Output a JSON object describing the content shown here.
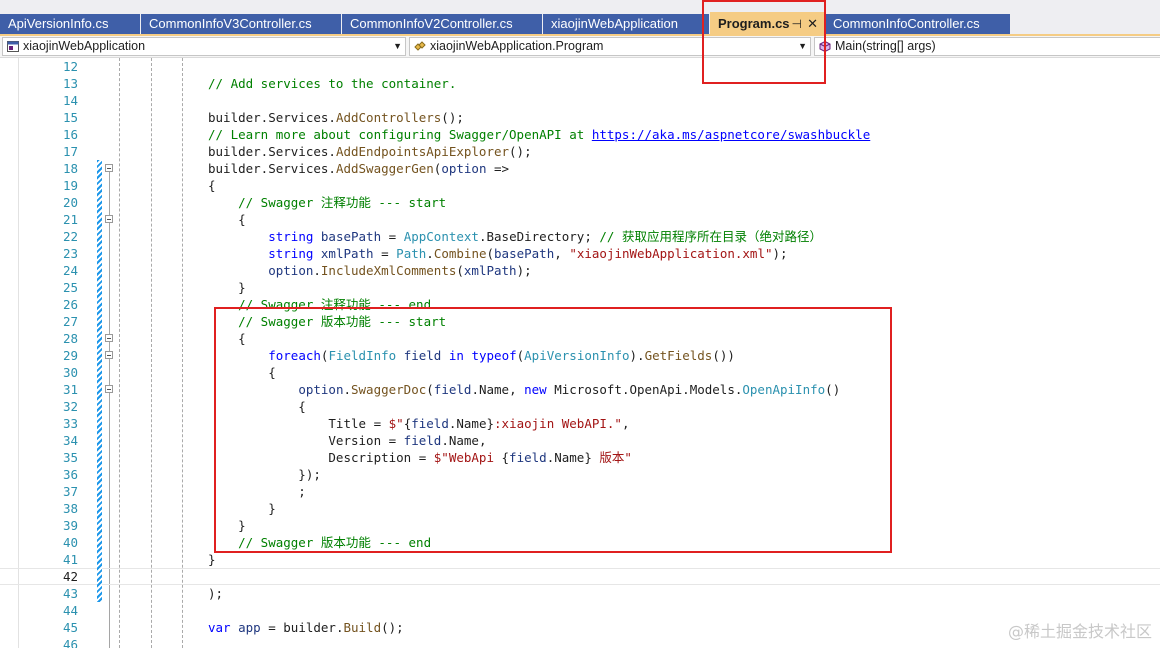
{
  "tabs": [
    {
      "label": "ApiVersionInfo.cs",
      "active": false
    },
    {
      "label": "CommonInfoV3Controller.cs",
      "active": false
    },
    {
      "label": "CommonInfoV2Controller.cs",
      "active": false
    },
    {
      "label": "xiaojinWebApplication",
      "active": false
    },
    {
      "label": "Program.cs",
      "active": true,
      "pin_icon": "pin-icon",
      "close_icon": "close-icon"
    },
    {
      "label": "CommonInfoController.cs",
      "active": false
    }
  ],
  "navbar": {
    "project": {
      "label": "xiaojinWebApplication",
      "icon": "csharp-project-icon"
    },
    "class": {
      "label": "xiaojinWebApplication.Program",
      "icon": "class-icon"
    },
    "member": {
      "label": "Main(string[] args)",
      "icon": "method-cube-icon"
    }
  },
  "editor": {
    "current_line": 42,
    "lines": [
      {
        "n": 12,
        "tokens": []
      },
      {
        "n": 13,
        "tokens": [
          {
            "t": "// Add services to the container.",
            "c": "comment"
          }
        ]
      },
      {
        "n": 14,
        "tokens": []
      },
      {
        "n": 15,
        "tokens": [
          {
            "t": "builder.Services.",
            "c": "plain"
          },
          {
            "t": "AddControllers",
            "c": "method"
          },
          {
            "t": "();",
            "c": "plain"
          }
        ]
      },
      {
        "n": 16,
        "tokens": [
          {
            "t": "// Learn more about configuring Swagger/OpenAPI at ",
            "c": "comment"
          },
          {
            "t": "https://aka.ms/aspnetcore/swashbuckle",
            "c": "link"
          }
        ]
      },
      {
        "n": 17,
        "tokens": [
          {
            "t": "builder.Services.",
            "c": "plain"
          },
          {
            "t": "AddEndpointsApiExplorer",
            "c": "method"
          },
          {
            "t": "();",
            "c": "plain"
          }
        ]
      },
      {
        "n": 18,
        "tokens": [
          {
            "t": "builder.Services.",
            "c": "plain"
          },
          {
            "t": "AddSwaggerGen",
            "c": "method"
          },
          {
            "t": "(",
            "c": "plain"
          },
          {
            "t": "option",
            "c": "param"
          },
          {
            "t": " =>",
            "c": "plain"
          }
        ],
        "fold": true,
        "change": true
      },
      {
        "n": 19,
        "tokens": [
          {
            "t": "{",
            "c": "plain"
          }
        ],
        "change": true
      },
      {
        "n": 20,
        "tokens": [
          {
            "t": "    // Swagger 注释功能 --- start",
            "c": "comment"
          }
        ],
        "change": true
      },
      {
        "n": 21,
        "tokens": [
          {
            "t": "    {",
            "c": "plain"
          }
        ],
        "fold": true,
        "change": true
      },
      {
        "n": 22,
        "tokens": [
          {
            "t": "        ",
            "c": "plain"
          },
          {
            "t": "string",
            "c": "kw"
          },
          {
            "t": " ",
            "c": "plain"
          },
          {
            "t": "basePath",
            "c": "param"
          },
          {
            "t": " = ",
            "c": "plain"
          },
          {
            "t": "AppContext",
            "c": "type"
          },
          {
            "t": ".BaseDirectory; ",
            "c": "plain"
          },
          {
            "t": "// 获取应用程序所在目录（绝对路径）",
            "c": "comment"
          }
        ],
        "change": true
      },
      {
        "n": 23,
        "tokens": [
          {
            "t": "        ",
            "c": "plain"
          },
          {
            "t": "string",
            "c": "kw"
          },
          {
            "t": " ",
            "c": "plain"
          },
          {
            "t": "xmlPath",
            "c": "param"
          },
          {
            "t": " = ",
            "c": "plain"
          },
          {
            "t": "Path",
            "c": "type"
          },
          {
            "t": ".",
            "c": "plain"
          },
          {
            "t": "Combine",
            "c": "method"
          },
          {
            "t": "(",
            "c": "plain"
          },
          {
            "t": "basePath",
            "c": "param"
          },
          {
            "t": ", ",
            "c": "plain"
          },
          {
            "t": "\"xiaojinWebApplication.xml\"",
            "c": "str"
          },
          {
            "t": ");",
            "c": "plain"
          }
        ],
        "change": true
      },
      {
        "n": 24,
        "tokens": [
          {
            "t": "        ",
            "c": "plain"
          },
          {
            "t": "option",
            "c": "param"
          },
          {
            "t": ".",
            "c": "plain"
          },
          {
            "t": "IncludeXmlComments",
            "c": "method"
          },
          {
            "t": "(",
            "c": "plain"
          },
          {
            "t": "xmlPath",
            "c": "param"
          },
          {
            "t": ");",
            "c": "plain"
          }
        ],
        "change": true
      },
      {
        "n": 25,
        "tokens": [
          {
            "t": "    }",
            "c": "plain"
          }
        ],
        "change": true
      },
      {
        "n": 26,
        "tokens": [
          {
            "t": "    // Swagger 注释功能 --- end",
            "c": "comment"
          }
        ],
        "change": true
      },
      {
        "n": 27,
        "tokens": [
          {
            "t": "    // Swagger 版本功能 --- start",
            "c": "comment"
          }
        ],
        "change": true
      },
      {
        "n": 28,
        "tokens": [
          {
            "t": "    {",
            "c": "plain"
          }
        ],
        "fold": true,
        "change": true
      },
      {
        "n": 29,
        "tokens": [
          {
            "t": "        ",
            "c": "plain"
          },
          {
            "t": "foreach",
            "c": "kw"
          },
          {
            "t": "(",
            "c": "plain"
          },
          {
            "t": "FieldInfo",
            "c": "type"
          },
          {
            "t": " ",
            "c": "plain"
          },
          {
            "t": "field",
            "c": "param"
          },
          {
            "t": " ",
            "c": "plain"
          },
          {
            "t": "in",
            "c": "kw"
          },
          {
            "t": " ",
            "c": "plain"
          },
          {
            "t": "typeof",
            "c": "kw"
          },
          {
            "t": "(",
            "c": "plain"
          },
          {
            "t": "ApiVersionInfo",
            "c": "type"
          },
          {
            "t": ").",
            "c": "plain"
          },
          {
            "t": "GetFields",
            "c": "method"
          },
          {
            "t": "())",
            "c": "plain"
          }
        ],
        "fold": true,
        "change": true
      },
      {
        "n": 30,
        "tokens": [
          {
            "t": "        {",
            "c": "plain"
          }
        ],
        "change": true
      },
      {
        "n": 31,
        "tokens": [
          {
            "t": "            ",
            "c": "plain"
          },
          {
            "t": "option",
            "c": "param"
          },
          {
            "t": ".",
            "c": "plain"
          },
          {
            "t": "SwaggerDoc",
            "c": "method"
          },
          {
            "t": "(",
            "c": "plain"
          },
          {
            "t": "field",
            "c": "param"
          },
          {
            "t": ".Name, ",
            "c": "plain"
          },
          {
            "t": "new",
            "c": "kw"
          },
          {
            "t": " Microsoft.OpenApi.Models.",
            "c": "plain"
          },
          {
            "t": "OpenApiInfo",
            "c": "type"
          },
          {
            "t": "()",
            "c": "plain"
          }
        ],
        "fold": true,
        "change": true
      },
      {
        "n": 32,
        "tokens": [
          {
            "t": "            {",
            "c": "plain"
          }
        ],
        "change": true
      },
      {
        "n": 33,
        "tokens": [
          {
            "t": "                Title = ",
            "c": "plain"
          },
          {
            "t": "$\"",
            "c": "str"
          },
          {
            "t": "{",
            "c": "plain"
          },
          {
            "t": "field",
            "c": "param"
          },
          {
            "t": ".Name}",
            "c": "plain"
          },
          {
            "t": ":xiaojin WebAPI.\"",
            "c": "str"
          },
          {
            "t": ",",
            "c": "plain"
          }
        ],
        "change": true
      },
      {
        "n": 34,
        "tokens": [
          {
            "t": "                Version = ",
            "c": "plain"
          },
          {
            "t": "field",
            "c": "param"
          },
          {
            "t": ".Name,",
            "c": "plain"
          }
        ],
        "change": true
      },
      {
        "n": 35,
        "tokens": [
          {
            "t": "                Description = ",
            "c": "plain"
          },
          {
            "t": "$\"WebApi ",
            "c": "str"
          },
          {
            "t": "{",
            "c": "plain"
          },
          {
            "t": "field",
            "c": "param"
          },
          {
            "t": ".Name}",
            "c": "plain"
          },
          {
            "t": " 版本\"",
            "c": "str"
          }
        ],
        "change": true
      },
      {
        "n": 36,
        "tokens": [
          {
            "t": "            });",
            "c": "plain"
          }
        ],
        "change": true
      },
      {
        "n": 37,
        "tokens": [
          {
            "t": "            ;",
            "c": "plain"
          }
        ],
        "change": true
      },
      {
        "n": 38,
        "tokens": [
          {
            "t": "        }",
            "c": "plain"
          }
        ],
        "change": true
      },
      {
        "n": 39,
        "tokens": [
          {
            "t": "    }",
            "c": "plain"
          }
        ],
        "change": true
      },
      {
        "n": 40,
        "tokens": [
          {
            "t": "    // Swagger 版本功能 --- end",
            "c": "comment"
          }
        ],
        "change": true
      },
      {
        "n": 41,
        "tokens": [
          {
            "t": "}",
            "c": "plain"
          }
        ],
        "change": true
      },
      {
        "n": 42,
        "tokens": [],
        "change": true
      },
      {
        "n": 43,
        "tokens": [
          {
            "t": ");",
            "c": "plain"
          }
        ],
        "change": true
      },
      {
        "n": 44,
        "tokens": []
      },
      {
        "n": 45,
        "tokens": [
          {
            "t": "var",
            "c": "kw"
          },
          {
            "t": " ",
            "c": "plain"
          },
          {
            "t": "app",
            "c": "param"
          },
          {
            "t": " = builder.",
            "c": "plain"
          },
          {
            "t": "Build",
            "c": "method"
          },
          {
            "t": "();",
            "c": "plain"
          }
        ]
      },
      {
        "n": 46,
        "tokens": []
      }
    ]
  },
  "colors": {
    "comment": "#008000",
    "keyword": "#0000ff",
    "type": "#2b91af",
    "string": "#a31515",
    "method": "#74531f",
    "annotation_red": "#e02020",
    "active_tab": "#f5cc84",
    "inactive_tab": "#3f5fa8"
  },
  "watermark": "@稀土掘金技术社区"
}
